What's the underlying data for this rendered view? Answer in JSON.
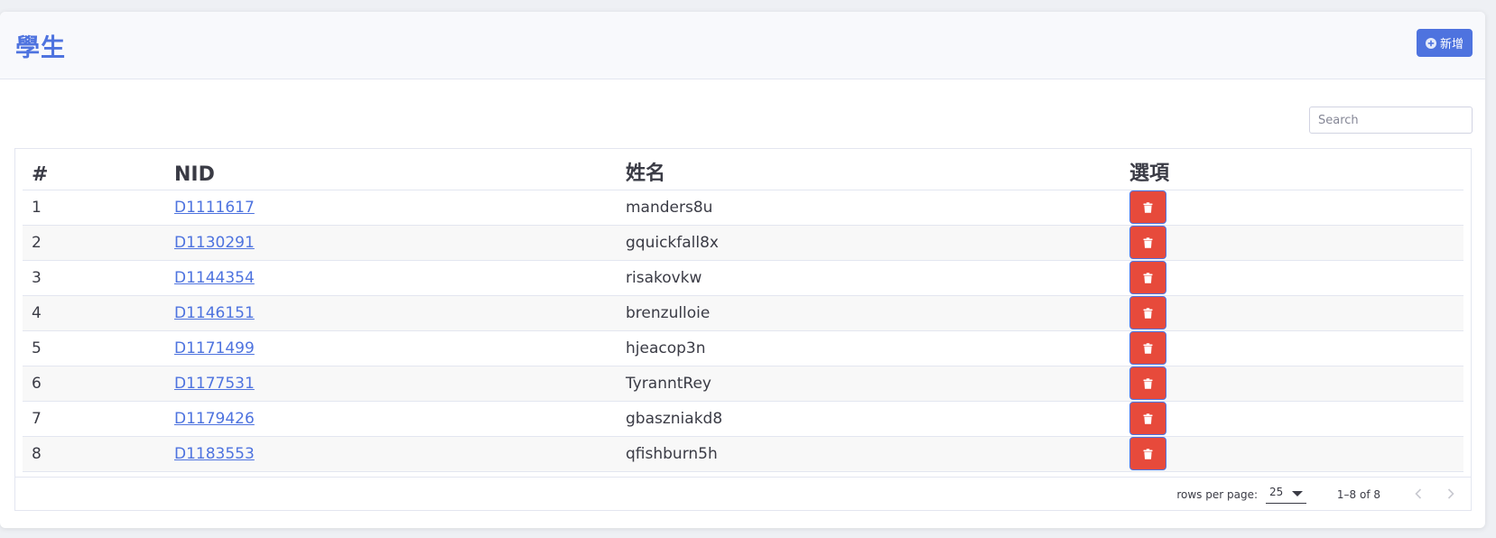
{
  "header": {
    "title": "學生",
    "add_button_label": "新增"
  },
  "search": {
    "placeholder": "Search"
  },
  "table": {
    "columns": [
      "#",
      "NID",
      "姓名",
      "選項"
    ],
    "rows": [
      {
        "num": "1",
        "nid": "D1111617",
        "name": "manders8u"
      },
      {
        "num": "2",
        "nid": "D1130291",
        "name": "gquickfall8x"
      },
      {
        "num": "3",
        "nid": "D1144354",
        "name": "risakovkw"
      },
      {
        "num": "4",
        "nid": "D1146151",
        "name": "brenzulloie"
      },
      {
        "num": "5",
        "nid": "D1171499",
        "name": "hjeacop3n"
      },
      {
        "num": "6",
        "nid": "D1177531",
        "name": "TyranntRey"
      },
      {
        "num": "7",
        "nid": "D1179426",
        "name": "gbaszniakd8"
      },
      {
        "num": "8",
        "nid": "D1183553",
        "name": "qfishburn5h"
      }
    ]
  },
  "pagination": {
    "rows_per_page_label": "rows per page:",
    "rows_per_page_value": "25",
    "range_text": "1–8 of 8"
  },
  "colors": {
    "primary": "#4e73df",
    "danger": "#e74a3b"
  },
  "icons": {
    "add": "plus-circle-icon",
    "delete": "trash-icon",
    "prev": "chevron-left-icon",
    "next": "chevron-right-icon",
    "dropdown": "caret-down-icon"
  }
}
